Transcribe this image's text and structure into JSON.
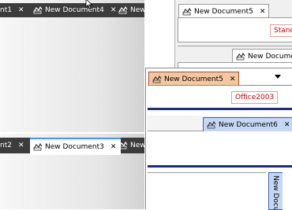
{
  "panels": {
    "dark_top": {
      "tabs": [
        {
          "label": "nt1"
        },
        {
          "label": "New Document4"
        },
        {
          "label": "New"
        }
      ],
      "close_glyph": "✕"
    },
    "dark_bottom": {
      "tabs": [
        {
          "label": "nt2"
        },
        {
          "label": "New Document3"
        },
        {
          "label": "New"
        }
      ],
      "close_glyph": "✕"
    },
    "right_top": {
      "tab": {
        "label": "New Document5"
      },
      "badge": "Stanc",
      "sub_tab": {
        "label": "New Document"
      }
    },
    "office": {
      "tab": {
        "label": "New Document5"
      },
      "badge": "Office2003",
      "tab2": {
        "label": "New Document6"
      },
      "vertical_tab": {
        "label": "New Docu"
      }
    }
  },
  "colors": {
    "dark": "#3c3c3c",
    "accent": "#3b98ff",
    "office_tab": "#f5c6a0",
    "office_blue": "#1a2d8a",
    "office_tab2": "#c4d8f5"
  }
}
